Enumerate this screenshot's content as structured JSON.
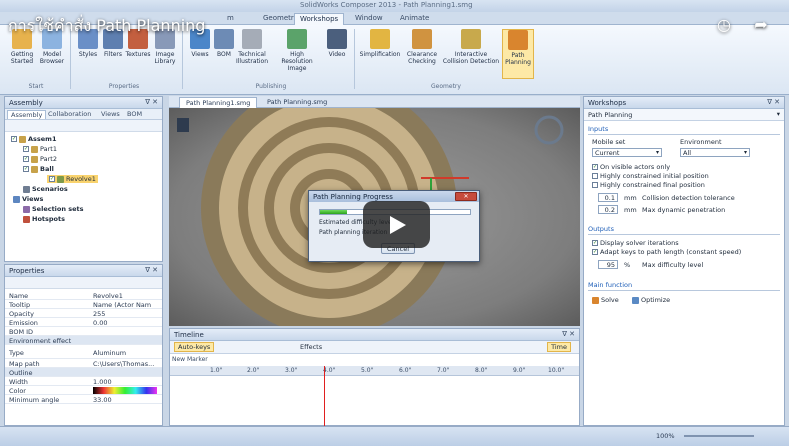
{
  "video": {
    "title": "การใช้คำสั่ง Path Planning",
    "clock_icon": "clock-icon",
    "share_icon": "share-icon"
  },
  "window": {
    "title": "SolidWorks Composer 2013 - Path Planning1.smg"
  },
  "ribbon": {
    "tabs": [
      "m",
      "Geometry",
      "Workshops",
      "Window",
      "Animate"
    ],
    "buttons": [
      {
        "label": "Getting Started"
      },
      {
        "label": "Model Browser"
      },
      {
        "label": "Styles"
      },
      {
        "label": "Filters"
      },
      {
        "label": "Textures"
      },
      {
        "label": "Image Library"
      },
      {
        "label": "Views"
      },
      {
        "label": "BOM"
      },
      {
        "label": "Technical Illustration"
      },
      {
        "label": "High Resolution Image"
      },
      {
        "label": "Video"
      },
      {
        "label": "Simplification"
      },
      {
        "label": "Clearance Checking"
      },
      {
        "label": "Interactive Collision Detection"
      },
      {
        "label": "Path Planning"
      }
    ],
    "groups": [
      "Start",
      "Properties",
      "Publishing",
      "Geometry"
    ]
  },
  "assembly": {
    "title": "Assembly",
    "tabs": [
      "Assembly",
      "Collaboration",
      "Views",
      "BOM"
    ],
    "tree": [
      {
        "label": "Assem1",
        "level": 0
      },
      {
        "label": "Part1",
        "level": 1
      },
      {
        "label": "Part2",
        "level": 1
      },
      {
        "label": "Ball",
        "level": 1
      },
      {
        "label": "Revolve1",
        "level": 2
      },
      {
        "label": "Scenarios",
        "level": 0
      },
      {
        "label": "Views",
        "level": 0
      },
      {
        "label": "Selection sets",
        "level": 0
      },
      {
        "label": "Hotspots",
        "level": 0
      }
    ]
  },
  "properties": {
    "title": "Properties",
    "rows": [
      {
        "k": "Name",
        "v": "Revolve1"
      },
      {
        "k": "Tooltip",
        "v": "Name (Actor Nam"
      },
      {
        "k": "Opacity",
        "v": "255"
      },
      {
        "k": "Emission",
        "v": "0.00"
      },
      {
        "k": "BOM ID",
        "v": ""
      },
      {
        "k": "Environment effect",
        "v": "",
        "sec": true
      },
      {
        "k": "Type",
        "v": "Aluminum"
      },
      {
        "k": "Map path",
        "v": "C:\\Users\\Thomas..."
      },
      {
        "k": "Outline",
        "v": "",
        "sec": true
      },
      {
        "k": "Width",
        "v": "1.000"
      },
      {
        "k": "Color",
        "v": ""
      },
      {
        "k": "Minimum angle",
        "v": "33.00"
      }
    ]
  },
  "documents": {
    "tabs": [
      "Path Planning1.smg",
      "Path Planning.smg"
    ]
  },
  "dialog": {
    "title": "Path Planning Progress",
    "progress": 0.18,
    "line1": "Estimated difficulty level",
    "line2": "Path planning iteration",
    "cancel": "Cancel"
  },
  "timeline": {
    "title": "Timeline",
    "auto_keys": "Auto-keys",
    "effects": "Effects",
    "time_label": "Time",
    "track_label": "New Marker",
    "ticks": [
      "1.0\"",
      "2.0\"",
      "3.0\"",
      "4.0\"",
      "5.0\"",
      "6.0\"",
      "7.0\"",
      "8.0\"",
      "9.0\"",
      "10.0\""
    ]
  },
  "workshop": {
    "title": "Workshops",
    "name": "Path Planning",
    "inputs_head": "Inputs",
    "mobile_set_label": "Mobile set",
    "mobile_set_value": "Current",
    "environment_label": "Environment",
    "environment_value": "All",
    "check_visible": "On visible actors only",
    "check_initial": "Highly constrained initial position",
    "check_final": "Highly constrained final position",
    "tolerance_value": "0.1",
    "tolerance_unit": "mm",
    "tolerance_label": "Collision detection tolerance",
    "penetration_value": "0.2",
    "penetration_unit": "mm",
    "penetration_label": "Max dynamic penetration",
    "outputs_head": "Outputs",
    "check_display": "Display solver iterations",
    "check_adapt": "Adapt keys to path length (constant speed)",
    "difficulty_value": "95",
    "difficulty_unit": "%",
    "difficulty_label": "Max difficulty level",
    "main_head": "Main function",
    "solve": "Solve",
    "optimize": "Optimize"
  },
  "status": {
    "zoom": "100%"
  }
}
